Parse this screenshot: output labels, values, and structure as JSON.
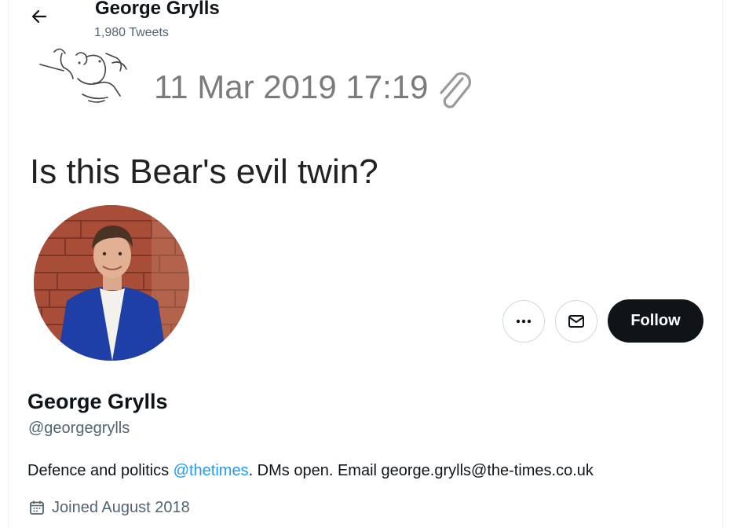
{
  "header": {
    "name": "George Grylls",
    "tweet_count": "1,980 Tweets"
  },
  "banner": {
    "timestamp": "11 Mar 2019 17:19",
    "caption": "Is this Bear's evil twin?"
  },
  "actions": {
    "follow_label": "Follow",
    "more_icon": "more-icon",
    "message_icon": "envelope-icon"
  },
  "profile": {
    "name": "George Grylls",
    "handle": "@georgegrylls",
    "bio_prefix": "Defence and politics ",
    "bio_mention": "@thetimes",
    "bio_suffix": ". DMs open. Email george.grylls@the-times.co.uk",
    "joined": "Joined August 2018"
  },
  "colors": {
    "accent": "#1d9bf0",
    "follow_bg": "#0f1419",
    "secondary_text": "#536471"
  }
}
